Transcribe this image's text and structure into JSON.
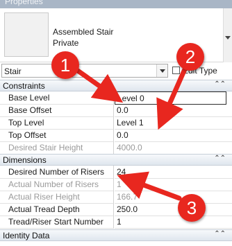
{
  "panel": {
    "title": "Properties"
  },
  "type": {
    "family_line": "Assembled Stair",
    "type_line": "Private"
  },
  "selector": {
    "value": "Stair",
    "edit_type_label": "Edit Type"
  },
  "groups": {
    "constraints": "Constraints",
    "dimensions": "Dimensions",
    "identity": "Identity Data"
  },
  "constraints": [
    {
      "name": "Base Level",
      "value": "Level 0"
    },
    {
      "name": "Base Offset",
      "value": "0.0"
    },
    {
      "name": "Top Level",
      "value": "Level 1"
    },
    {
      "name": "Top Offset",
      "value": "0.0"
    },
    {
      "name": "Desired Stair Height",
      "value": "4000.0"
    }
  ],
  "dimensions": [
    {
      "name": "Desired Number of Risers",
      "value": "24"
    },
    {
      "name": "Actual Number of Risers",
      "value": "1"
    },
    {
      "name": "Actual Riser Height",
      "value": "166.7"
    },
    {
      "name": "Actual Tread Depth",
      "value": "250.0"
    },
    {
      "name": "Tread/Riser Start Number",
      "value": "1"
    }
  ],
  "annotations": {
    "badge1": "1",
    "badge2": "2",
    "badge3": "3",
    "color": "#e8271f"
  },
  "icons": {
    "collapse": "double-chevron-up-icon",
    "edit_type": "edit-type-icon",
    "dropdown": "chevron-down-icon"
  }
}
